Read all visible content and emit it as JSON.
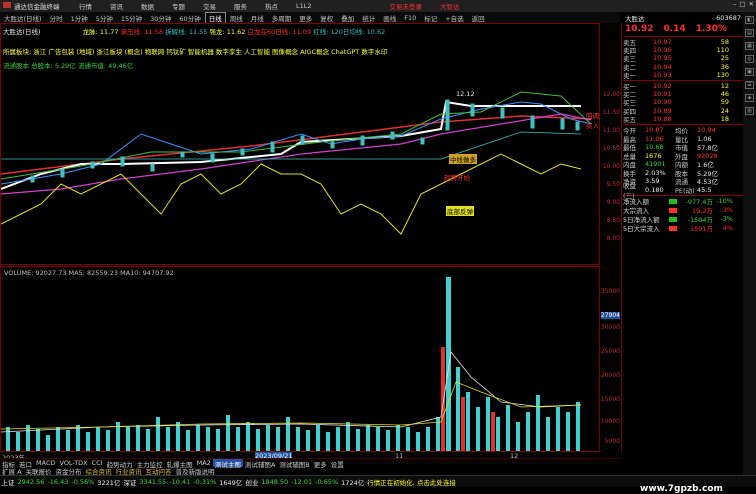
{
  "menubar": {
    "logo": "通达信金融终端",
    "items": [
      "行情",
      "资讯",
      "数据",
      "专题",
      "交易",
      "服务",
      "热点",
      "L1L2"
    ],
    "notice": "交易未登录",
    "login": "大智达"
  },
  "toolbar": {
    "stock": "大胜达(日线)",
    "items": [
      "分时",
      "1分钟",
      "5分钟",
      "15分钟",
      "30分钟",
      "60分钟",
      "日线",
      "周线",
      "月线",
      "多周期",
      "更多"
    ],
    "active": "日线",
    "subitems": [
      "复权",
      "叠加",
      "统计",
      "画线",
      "F10",
      "标记",
      "+自选",
      "返回"
    ]
  },
  "chart_top": {
    "title": "大胜达(日线)",
    "indicator": "龙脉: 11.77",
    "ind_vals": [
      "承压线: 11.58",
      "拆解线: 11.55",
      "强龙: 11.62",
      "白龙在60日线: 11.09",
      "红线: 120日均线: 10.62"
    ],
    "concepts": "所属板块: 浙江 广告包装 (地域) 浙江板块 (概念) 物联网 钙钛矿 智能机器 数字孪生 人工智能 图像概念 AIGC概念 ChatGPT 数字水印",
    "float": "流通股本 总股本: 5.29亿 流通市值: 49.46亿",
    "ylabels": [
      "12.00",
      "11.50",
      "11.00",
      "10.50",
      "10.00",
      "9.50",
      "9.00",
      "8.50",
      "8.00"
    ],
    "annotations": [
      "12.12",
      "中线做多",
      "趋势开始",
      "底部反弹",
      "回调买入"
    ]
  },
  "volume": {
    "info": "VOLUME: 92027.73  MA5: 82559.23  MA10: 94707.92",
    "ylabels": [
      "35000",
      "30000",
      "25000",
      "20000",
      "15000",
      "10000",
      "5000"
    ],
    "mark": "27904",
    "dates": [
      "2023年",
      "2023/09/21",
      "11",
      "12"
    ]
  },
  "tabs1": {
    "items": [
      "指标",
      "若口",
      "MACD",
      "VOL-TDX",
      "CCI",
      "趋势动力",
      "主力监控",
      "轧爆主图",
      "MA2",
      "测试主图",
      "测试辅图A",
      "测试辅图B",
      "更多",
      "设置"
    ],
    "active": "测试主图"
  },
  "tabs2": {
    "items": [
      "扩展 A",
      "关联报价",
      "资金分布",
      "综合资讯",
      "行业资讯",
      "互动问答",
      "普及新版说明"
    ]
  },
  "status": {
    "items": [
      {
        "n": "上证",
        "v": "2942.56",
        "d": "-16.43",
        "p": "-0.56%",
        "a": "3221亿"
      },
      {
        "n": "深证",
        "v": "3341.55",
        "d": "-10.41",
        "p": "-0.31%",
        "a": "1649亿"
      },
      {
        "n": "创业",
        "v": "1848.50",
        "d": "-12.01",
        "p": "-0.65%",
        "a": "1724亿"
      }
    ],
    "msg": "行情正在初始化, 点击此处连接"
  },
  "right": {
    "code": "603687",
    "name": "大胜达",
    "price": "10.92",
    "chg": "0.14",
    "pct": "1.30%",
    "asks": [
      {
        "l": "卖五",
        "p": "10.97",
        "v": "58"
      },
      {
        "l": "卖四",
        "p": "10.96",
        "v": "110"
      },
      {
        "l": "卖三",
        "p": "10.95",
        "v": "25"
      },
      {
        "l": "卖二",
        "p": "10.94",
        "v": "36"
      },
      {
        "l": "卖一",
        "p": "10.93",
        "v": "130"
      }
    ],
    "bids": [
      {
        "l": "买一",
        "p": "10.92",
        "v": "12"
      },
      {
        "l": "买二",
        "p": "10.91",
        "v": "46"
      },
      {
        "l": "买三",
        "p": "10.90",
        "v": "59"
      },
      {
        "l": "买四",
        "p": "10.89",
        "v": "24"
      },
      {
        "l": "买五",
        "p": "10.88",
        "v": "18"
      }
    ],
    "quote": [
      [
        "今开",
        "10.87",
        "均价",
        "10.94"
      ],
      [
        "最高",
        "11.06",
        "量比",
        "1.06"
      ],
      [
        "最低",
        "10.68",
        "市值",
        "57.8亿"
      ],
      [
        "总量",
        "1676",
        "外盘",
        "92028"
      ],
      [
        "内盘",
        "41901",
        "内额",
        "1.6亿"
      ],
      [
        "换手",
        "2.03%",
        "股本",
        "5.29亿"
      ],
      [
        "净资",
        "3.59",
        "流通",
        "4.53亿"
      ],
      [
        "收益(三)",
        "0.180",
        "PE(动)",
        "45.5"
      ]
    ],
    "flows": [
      {
        "l": "净流入额",
        "v": "-977.4万",
        "p": "-10%",
        "c": "#20c020"
      },
      {
        "l": "大宗流入",
        "v": "19.2万",
        "p": "3%",
        "c": "#ff3030"
      },
      {
        "l": "5日净流入额",
        "v": "-1504万",
        "p": "-3%",
        "c": "#20c020"
      },
      {
        "l": "5日大宗流入",
        "v": "1591万",
        "p": "4%",
        "c": "#ff3030"
      }
    ]
  },
  "watermark": "www.7gpzb.com"
}
